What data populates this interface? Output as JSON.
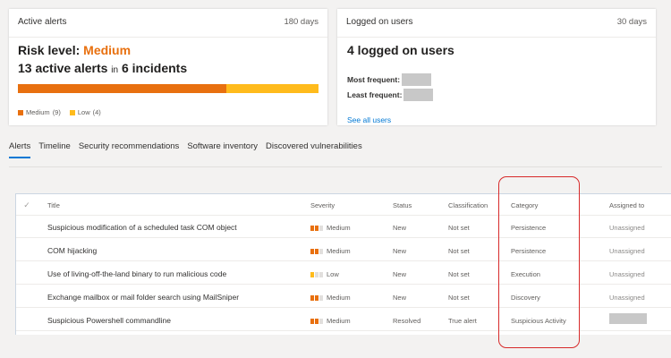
{
  "alerts_card": {
    "title": "Active alerts",
    "period": "180 days",
    "risk_prefix": "Risk level:",
    "risk_value": "Medium",
    "alerts_count_text": "13 active alerts",
    "in_word": "in",
    "incidents_text": "6 incidents",
    "severity_breakdown": [
      {
        "label": "Medium",
        "count": "(9)",
        "value": 9,
        "color": "#e8700f"
      },
      {
        "label": "Low",
        "count": "(4)",
        "value": 4,
        "color": "#ffbb1c"
      }
    ]
  },
  "users_card": {
    "title": "Logged on users",
    "period": "30 days",
    "headline": "4 logged on users",
    "most_label": "Most frequent:",
    "least_label": "Least frequent:",
    "see_all": "See all users"
  },
  "tabs": [
    {
      "label": "Alerts",
      "active": true
    },
    {
      "label": "Timeline"
    },
    {
      "label": "Security recommendations"
    },
    {
      "label": "Software inventory"
    },
    {
      "label": "Discovered vulnerabilities"
    }
  ],
  "table": {
    "check_icon": "check-icon",
    "columns": [
      "Title",
      "Severity",
      "Status",
      "Classification",
      "Category",
      "Assigned to"
    ],
    "rows": [
      {
        "title": "Suspicious modification of a scheduled task COM object",
        "severity": "Medium",
        "status": "New",
        "classification": "Not set",
        "category": "Persistence",
        "assigned": "Unassigned"
      },
      {
        "title": "COM hijacking",
        "severity": "Medium",
        "status": "New",
        "classification": "Not set",
        "category": "Persistence",
        "assigned": "Unassigned"
      },
      {
        "title": "Use of living-off-the-land binary to run malicious code",
        "severity": "Low",
        "status": "New",
        "classification": "Not set",
        "category": "Execution",
        "assigned": "Unassigned"
      },
      {
        "title": "Exchange mailbox or mail folder search using MailSniper",
        "severity": "Medium",
        "status": "New",
        "classification": "Not set",
        "category": "Discovery",
        "assigned": "Unassigned"
      },
      {
        "title": "Suspicious Powershell commandline",
        "severity": "Medium",
        "status": "Resolved",
        "classification": "True alert",
        "category": "Suspicious Activity",
        "assigned": ""
      }
    ]
  },
  "colors": {
    "medium": "#e8700f",
    "low": "#ffbb1c",
    "accent": "#0078d4",
    "highlight": "#d72a2a"
  }
}
